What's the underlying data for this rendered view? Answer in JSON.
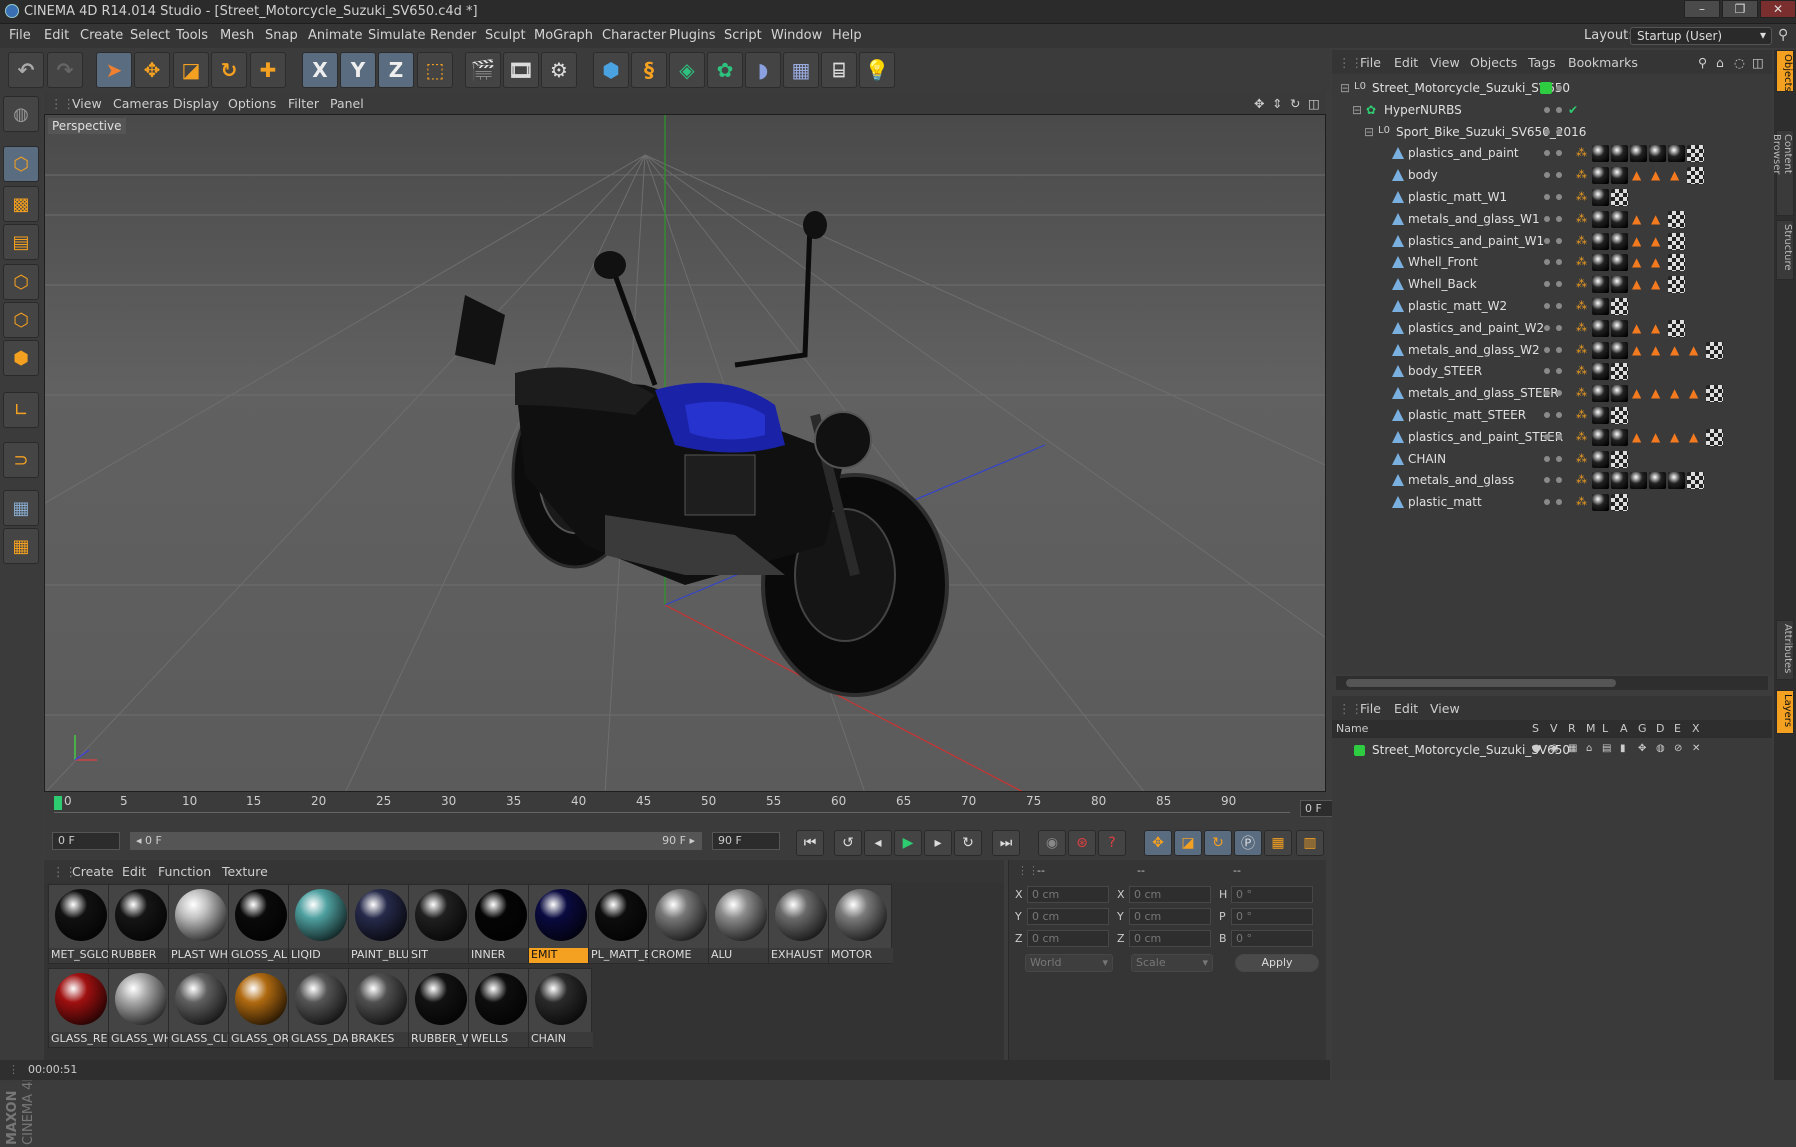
{
  "window": {
    "title": "CINEMA 4D R14.014 Studio - [Street_Motorcycle_Suzuki_SV650.c4d *]",
    "controls": [
      "–",
      "❐",
      "✕"
    ]
  },
  "menubar": {
    "items": [
      "File",
      "Edit",
      "Create",
      "Select",
      "Tools",
      "Mesh",
      "Snap",
      "Animate",
      "Simulate",
      "Render",
      "Sculpt",
      "MoGraph",
      "Character",
      "Plugins",
      "Script",
      "Window",
      "Help"
    ],
    "layout_label": "Layout:",
    "layout_value": "Startup (User)"
  },
  "toolbar": {
    "icons": [
      "undo-icon",
      "redo-icon",
      "live-selection-icon",
      "move-icon",
      "scale-icon",
      "rotate-icon",
      "add-icon",
      "x-axis-icon",
      "y-axis-icon",
      "z-axis-icon",
      "coordinate-system-icon",
      "render-view-icon",
      "render-picture-viewer-icon",
      "edit-render-settings-icon",
      "cube-icon",
      "spline-icon",
      "nurbs-icon",
      "array-icon",
      "deformer-icon",
      "floor-icon",
      "camera-icon",
      "light-icon"
    ],
    "x_label": "X",
    "y_label": "Y",
    "z_label": "Z"
  },
  "viewport": {
    "menu": [
      "View",
      "Cameras",
      "Display",
      "Options",
      "Filter",
      "Panel"
    ],
    "label": "Perspective"
  },
  "timeline": {
    "ticks": [
      "0",
      "5",
      "10",
      "15",
      "20",
      "25",
      "30",
      "35",
      "40",
      "45",
      "50",
      "55",
      "60",
      "65",
      "70",
      "75",
      "80",
      "85",
      "90"
    ],
    "frame_display": "0 F",
    "start_field": "0 F",
    "range_start": "◂ 0 F",
    "range_end": "90 F ▸",
    "end_field": "90 F"
  },
  "materials": {
    "menu": [
      "Create",
      "Edit",
      "Function",
      "Texture"
    ],
    "items": [
      {
        "label": "MET_SGLOS",
        "color": "#111111",
        "selected": false
      },
      {
        "label": "RUBBER",
        "color": "#151515",
        "selected": false
      },
      {
        "label": "PLAST WHI",
        "color": "#bfbfbf",
        "selected": false
      },
      {
        "label": "GLOSS_ALL",
        "color": "#0a0a0a",
        "selected": false
      },
      {
        "label": "LIQID",
        "color": "#4fa0a0",
        "selected": false
      },
      {
        "label": "PAINT_BLUI",
        "color": "#262a4a",
        "selected": false
      },
      {
        "label": "SIT",
        "color": "#202020",
        "selected": false
      },
      {
        "label": "INNER",
        "color": "#050505",
        "selected": false
      },
      {
        "label": "EMIT",
        "color": "#0a0a40",
        "selected": true
      },
      {
        "label": "PL_MATT_B",
        "color": "#0d0d0d",
        "selected": false
      },
      {
        "label": "CROME",
        "color": "#777777",
        "selected": false
      },
      {
        "label": "ALU",
        "color": "#8a8a8a",
        "selected": false
      },
      {
        "label": "EXHAUST",
        "color": "#6a6a6a",
        "selected": false
      },
      {
        "label": "MOTOR",
        "color": "#7a7a7a",
        "selected": false
      },
      {
        "label": "GLASS_RED",
        "color": "#a01010",
        "selected": false
      },
      {
        "label": "GLASS_WH",
        "color": "#a8a8a8",
        "selected": false
      },
      {
        "label": "GLASS_CLE",
        "color": "#606060",
        "selected": false
      },
      {
        "label": "GLASS_ORA",
        "color": "#b06a10",
        "selected": false
      },
      {
        "label": "GLASS_DAF",
        "color": "#555555",
        "selected": false
      },
      {
        "label": "BRAKES",
        "color": "#505050",
        "selected": false
      },
      {
        "label": "RUBBER_W",
        "color": "#121212",
        "selected": false
      },
      {
        "label": "WELLS",
        "color": "#0e0e0e",
        "selected": false
      },
      {
        "label": "CHAIN",
        "color": "#2a2a2a",
        "selected": false
      }
    ]
  },
  "coordinates": {
    "headers": [
      "--",
      "--",
      "--"
    ],
    "rows": [
      {
        "a": "X",
        "av": "0 cm",
        "b": "X",
        "bv": "0 cm",
        "c": "H",
        "cv": "0 °"
      },
      {
        "a": "Y",
        "av": "0 cm",
        "b": "Y",
        "bv": "0 cm",
        "c": "P",
        "cv": "0 °"
      },
      {
        "a": "Z",
        "av": "0 cm",
        "b": "Z",
        "bv": "0 cm",
        "c": "B",
        "cv": "0 °"
      }
    ],
    "world_select": "World",
    "scale_select": "Scale",
    "apply_label": "Apply"
  },
  "status": {
    "time": "00:00:51"
  },
  "object_manager": {
    "menu": [
      "File",
      "Edit",
      "View",
      "Objects",
      "Tags",
      "Bookmarks"
    ],
    "objects": [
      {
        "name": "Street_Motorcycle_Suzuki_SV650",
        "level": 0,
        "type": "null"
      },
      {
        "name": "HyperNURBS",
        "level": 1,
        "type": "nurbs"
      },
      {
        "name": "Sport_Bike_Suzuki_SV650_2016",
        "level": 2,
        "type": "null"
      },
      {
        "name": "plastics_and_paint",
        "level": 3,
        "type": "poly"
      },
      {
        "name": "body",
        "level": 3,
        "type": "poly"
      },
      {
        "name": "plastic_matt_W1",
        "level": 3,
        "type": "poly"
      },
      {
        "name": "metals_and_glass_W1",
        "level": 3,
        "type": "poly"
      },
      {
        "name": "plastics_and_paint_W1",
        "level": 3,
        "type": "poly"
      },
      {
        "name": "Whell_Front",
        "level": 3,
        "type": "poly"
      },
      {
        "name": "Whell_Back",
        "level": 3,
        "type": "poly"
      },
      {
        "name": "plastic_matt_W2",
        "level": 3,
        "type": "poly"
      },
      {
        "name": "plastics_and_paint_W2",
        "level": 3,
        "type": "poly"
      },
      {
        "name": "metals_and_glass_W2",
        "level": 3,
        "type": "poly"
      },
      {
        "name": "body_STEER",
        "level": 3,
        "type": "poly"
      },
      {
        "name": "metals_and_glass_STEER",
        "level": 3,
        "type": "poly"
      },
      {
        "name": "plastic_matt_STEER",
        "level": 3,
        "type": "poly"
      },
      {
        "name": "plastics_and_paint_STEER",
        "level": 3,
        "type": "poly"
      },
      {
        "name": "CHAIN",
        "level": 3,
        "type": "poly"
      },
      {
        "name": "metals_and_glass",
        "level": 3,
        "type": "poly"
      },
      {
        "name": "plastic_matt",
        "level": 3,
        "type": "poly"
      }
    ]
  },
  "layer_manager": {
    "menu": [
      "File",
      "Edit",
      "View"
    ],
    "columns": [
      "Name",
      "S",
      "V",
      "R",
      "M",
      "L",
      "A",
      "G",
      "D",
      "E",
      "X"
    ],
    "layers": [
      {
        "name": "Street_Motorcycle_Suzuki_SV650",
        "color": "#2ecc40"
      }
    ]
  },
  "right_tabs": [
    "Objects",
    "Content Browser",
    "Structure",
    "Attributes",
    "Layers"
  ],
  "colors": {
    "accent": "#f4a020",
    "selection_blue": "#5a6c80"
  }
}
